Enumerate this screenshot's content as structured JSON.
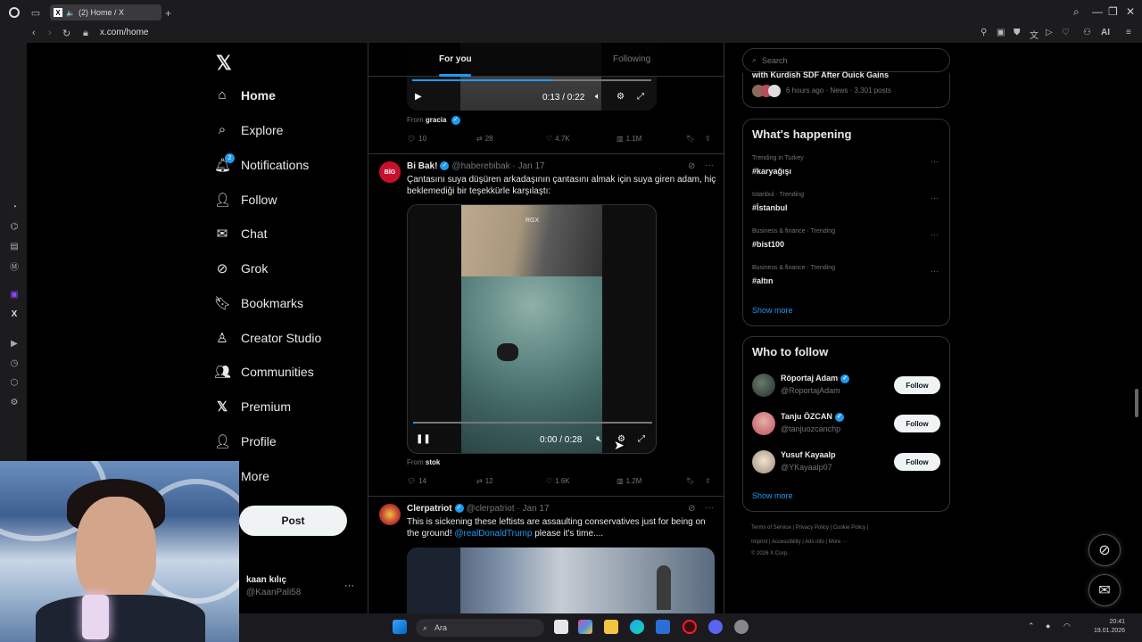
{
  "browser": {
    "tab_title": "(2) Home / X",
    "url": "x.com/home",
    "ai_label": "AI"
  },
  "sidebar": {
    "items": [
      {
        "label": "Home",
        "icon": "home-icon"
      },
      {
        "label": "Explore",
        "icon": "search-icon"
      },
      {
        "label": "Notifications",
        "icon": "bell-icon",
        "badge": "2"
      },
      {
        "label": "Follow",
        "icon": "person-plus-icon"
      },
      {
        "label": "Chat",
        "icon": "mail-icon"
      },
      {
        "label": "Grok",
        "icon": "grok-icon"
      },
      {
        "label": "Bookmarks",
        "icon": "bookmark-icon"
      },
      {
        "label": "Creator Studio",
        "icon": "creator-icon"
      },
      {
        "label": "Communities",
        "icon": "people-icon"
      },
      {
        "label": "Premium",
        "icon": "x-icon"
      },
      {
        "label": "Profile",
        "icon": "person-icon"
      },
      {
        "label": "More",
        "icon": "more-icon"
      }
    ],
    "post_label": "Post",
    "user": {
      "name": "kaan kılıç",
      "handle": "@KaanPali58"
    }
  },
  "feed": {
    "tabs": [
      "For you",
      "Following"
    ],
    "tweet1": {
      "time": "0:13 / 0:22",
      "from_label": "From",
      "from": "gracia",
      "replies": "10",
      "reposts": "28",
      "likes": "4.7K",
      "views": "1.1M"
    },
    "tweet2": {
      "name": "Bi Bak!",
      "handle": "@haberebibak",
      "date": "Jan 17",
      "dot": "·",
      "text": "Çantasını suya düşüren arkadaşının çantasını almak için suya giren adam, hiç beklemediği bir teşekkürle karşılaştı:",
      "watermark": "RGX",
      "time": "0:00 / 0:28",
      "progress": 0.0,
      "from_label": "From",
      "from": "stok",
      "replies": "14",
      "reposts": "12",
      "likes": "1.6K",
      "views": "1.2M"
    },
    "tweet3": {
      "name": "Clerpatriot",
      "handle": "@clerpatriot",
      "date": "Jan 17",
      "dot": "·",
      "text_before": "This is sickening these leftists are assaulting conservatives just for being on the ground! ",
      "mention": "@realDonaldTrump",
      "text_after": " please it's time...."
    }
  },
  "right": {
    "search_placeholder": "Search",
    "news_partial": "with Kurdish SDF After Quick Gains",
    "news_meta": "6 hours ago · News · 3,301 posts",
    "happening_title": "What's happening",
    "trends": [
      {
        "meta": "Trending in Turkey",
        "tag": "#karyağışı"
      },
      {
        "meta": "Istanbul · Trending",
        "tag": "#İstanbul"
      },
      {
        "meta": "Business & finance · Trending",
        "tag": "#bist100"
      },
      {
        "meta": "Business & finance · Trending",
        "tag": "#altın"
      }
    ],
    "show_more": "Show more",
    "wtf_title": "Who to follow",
    "wtf": [
      {
        "name": "Röportaj Adam",
        "handle": "@RoportajAdam",
        "verified": true,
        "button": "Follow"
      },
      {
        "name": "Tanju ÖZCAN",
        "handle": "@tanjuozcanchp",
        "verified": true,
        "button": "Follow"
      },
      {
        "name": "Yusuf Kayaalp",
        "handle": "@YKayaalp07",
        "verified": false,
        "button": "Follow"
      }
    ],
    "wtf_show_more": "Show more",
    "footer_line1": "Terms of Service  |  Privacy Policy  |  Cookie Policy  |",
    "footer_line2": "Imprint  |  Accessibility  |  Ads info  |  More ···",
    "footer_line3": "© 2026 X Corp."
  },
  "taskbar": {
    "search_label": "Ara",
    "time": "20:41",
    "date": "19.01.2026"
  },
  "colors": {
    "accent": "#1d9bf0",
    "bg": "#000000",
    "border": "#2f3336",
    "muted": "#71767b"
  }
}
